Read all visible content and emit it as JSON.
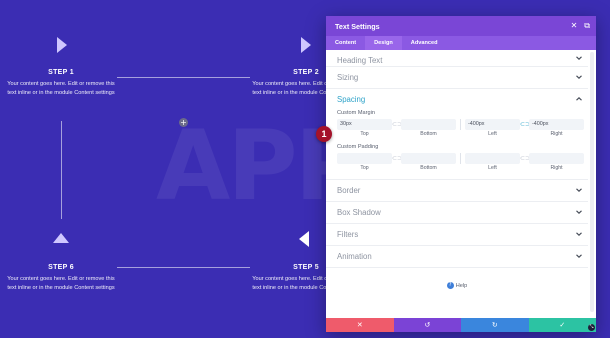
{
  "background": {
    "word": "APPRO",
    "add_icon": "plus-icon",
    "color": "#3b2db3"
  },
  "steps": [
    {
      "title": "STEP 1",
      "text": "Your content goes here. Edit or remove this text inline or in the module Content settings"
    },
    {
      "title": "STEP 2",
      "text": "Your content goes here. Edit or remove this text inline or in the module Content settings"
    },
    {
      "title": "STEP 6",
      "text": "Your content goes here. Edit or remove this text inline or in the module Content settings"
    },
    {
      "title": "STEP 5",
      "text": "Your content goes here. Edit or remove this text inline or in the module Content settings"
    }
  ],
  "panel": {
    "title": "Text Settings",
    "tabs": [
      {
        "label": "Content",
        "active": false
      },
      {
        "label": "Design",
        "active": true
      },
      {
        "label": "Advanced",
        "active": false
      }
    ],
    "sections_before": [
      {
        "label": "Heading Text"
      },
      {
        "label": "Sizing"
      }
    ],
    "spacing": {
      "label": "Spacing",
      "margin": {
        "label": "Custom Margin",
        "values": [
          "30px",
          "",
          "-400px",
          "-400px"
        ],
        "subs": [
          "Top",
          "Bottom",
          "Left",
          "Right"
        ]
      },
      "padding": {
        "label": "Custom Padding",
        "values": [
          "",
          "",
          "",
          ""
        ],
        "subs": [
          "Top",
          "Bottom",
          "Left",
          "Right"
        ]
      }
    },
    "sections_after": [
      {
        "label": "Border"
      },
      {
        "label": "Box Shadow"
      },
      {
        "label": "Filters"
      },
      {
        "label": "Animation"
      }
    ],
    "help": "Help",
    "accent": "#7a46d6",
    "footer_colors": {
      "cancel": "#ef5b6b",
      "undo": "#7b43d6",
      "redo": "#3a86dd",
      "save": "#2cc3a3"
    }
  },
  "badge": "1"
}
